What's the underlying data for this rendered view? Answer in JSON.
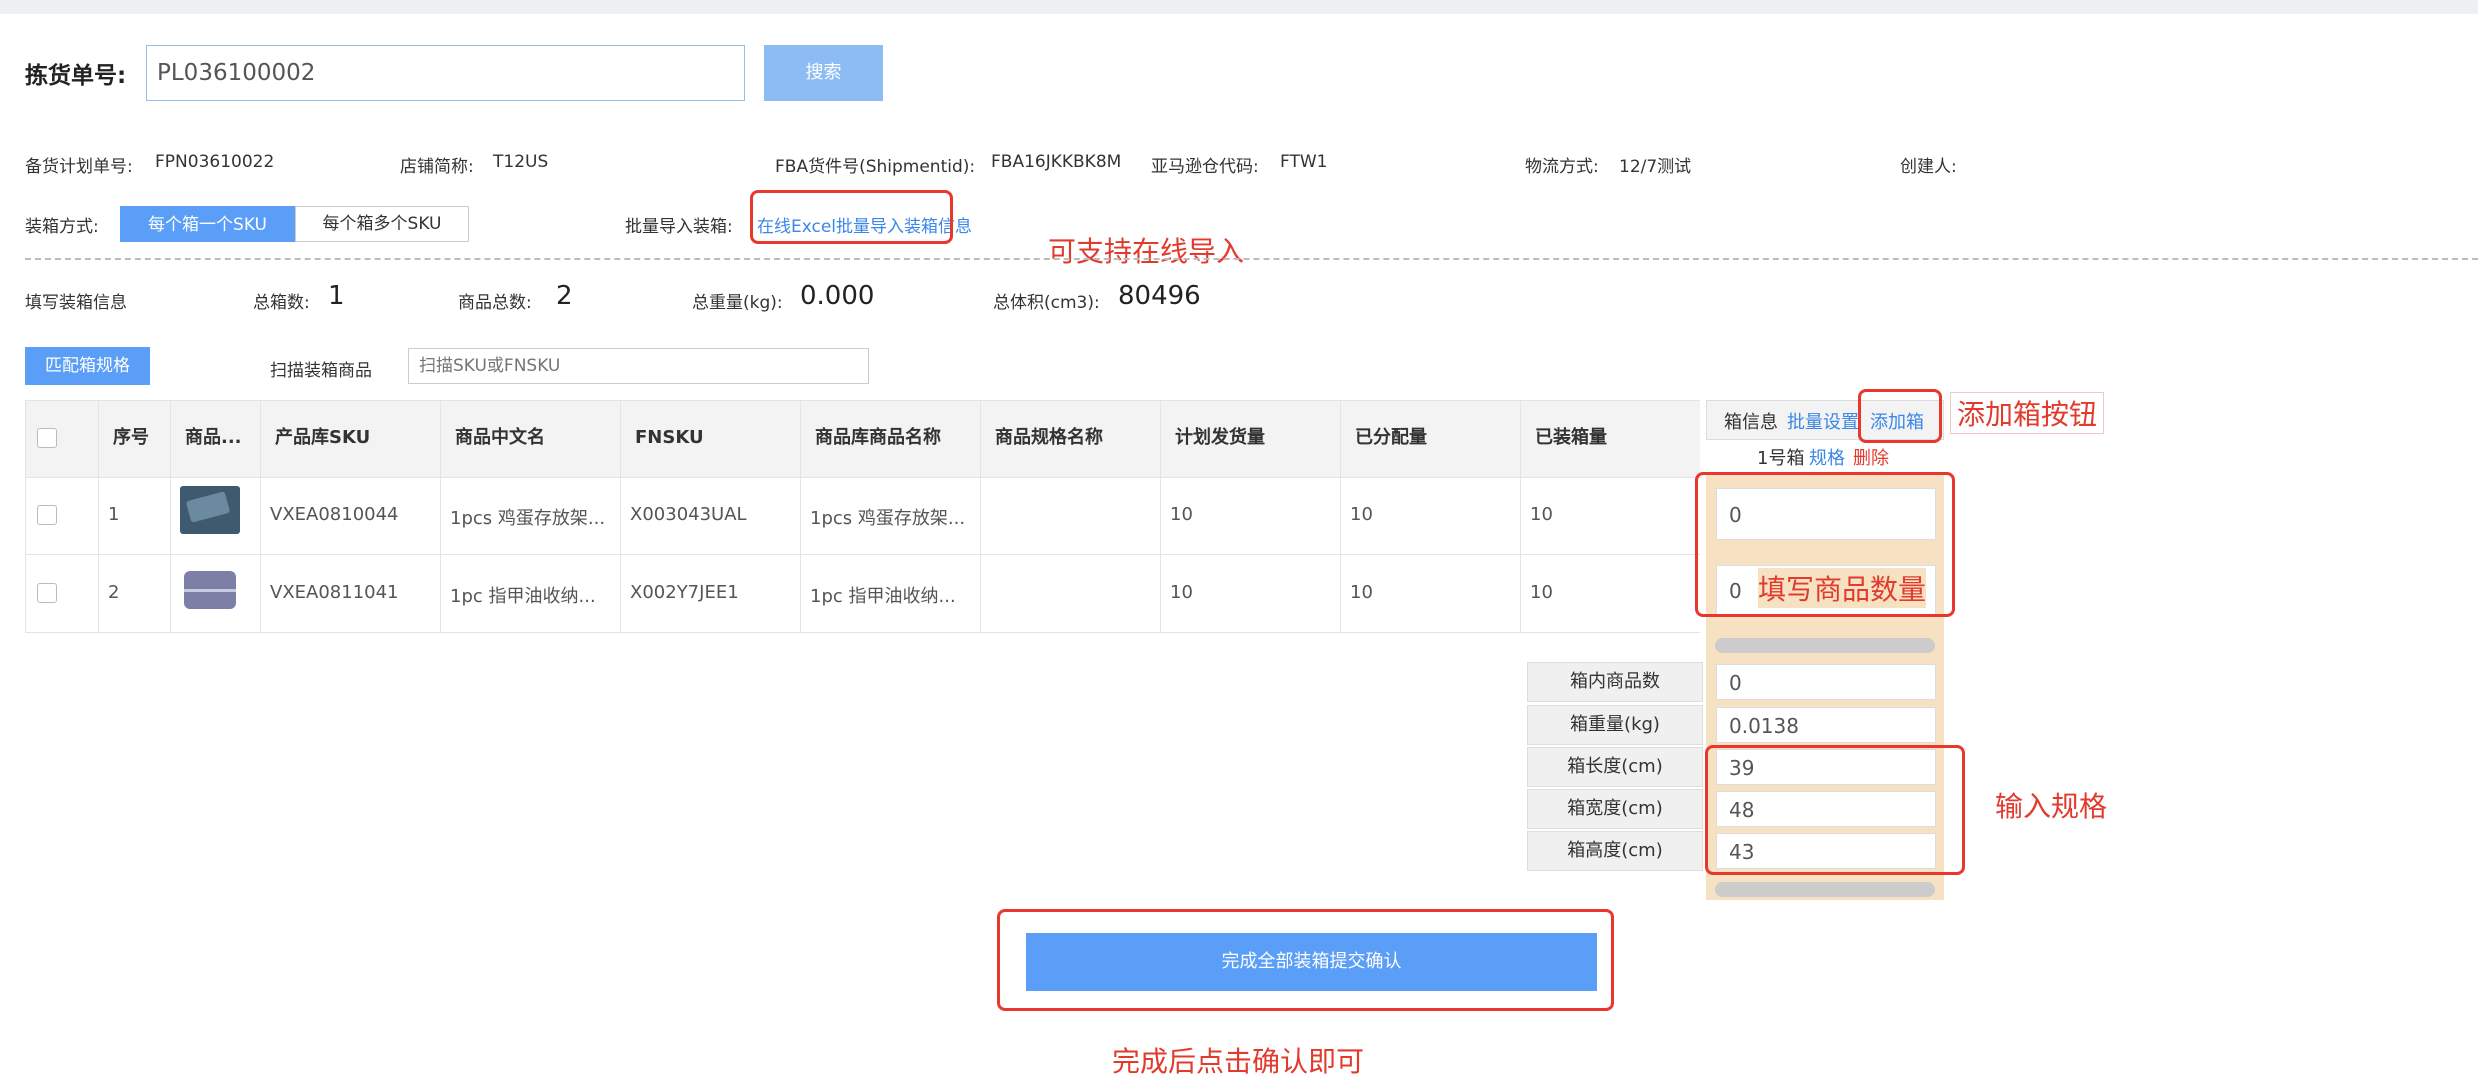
{
  "header": {
    "pick_label": "拣货单号:",
    "pick_value": "PL036100002",
    "search_button": "搜索"
  },
  "info": {
    "plan_label": "备货计划单号:",
    "plan_value": "FPN03610022",
    "shop_label": "店铺简称:",
    "shop_value": "T12US",
    "fba_label": "FBA货件号(Shipmentid):",
    "fba_value": "FBA16JKKBK8M",
    "amazon_label": "亚马逊仓代码:",
    "amazon_value": "FTW1",
    "logistics_label": "物流方式:",
    "logistics_value": "12/7测试",
    "creator_label": "创建人:"
  },
  "packing": {
    "method_label": "装箱方式:",
    "option_single": "每个箱一个SKU",
    "option_multi": "每个箱多个SKU",
    "import_label": "批量导入装箱:",
    "import_link": "在线Excel批量导入装箱信息"
  },
  "summary": {
    "fill_label": "填写装箱信息",
    "total_boxes_label": "总箱数:",
    "total_boxes_value": "1",
    "total_items_label": "商品总数:",
    "total_items_value": "2",
    "total_weight_label": "总重量(kg):",
    "total_weight_value": "0.000",
    "total_volume_label": "总体积(cm3):",
    "total_volume_value": "80496"
  },
  "toolbar": {
    "match_button": "匹配箱规格",
    "scan_label": "扫描装箱商品",
    "scan_placeholder": "扫描SKU或FNSKU"
  },
  "table": {
    "headers": [
      "序号",
      "商品...",
      "产品库SKU",
      "商品中文名",
      "FNSKU",
      "商品库商品名称",
      "商品规格名称",
      "计划发货量",
      "已分配量",
      "已装箱量"
    ],
    "rows": [
      {
        "index": "1",
        "sku": "VXEA0810044",
        "cn_name": "1pcs 鸡蛋存放架...",
        "fnsku": "X003043UAL",
        "lib_name": "1pcs 鸡蛋存放架...",
        "spec": "",
        "planned": "10",
        "allocated": "10",
        "packed": "10",
        "box_qty": "0"
      },
      {
        "index": "2",
        "sku": "VXEA0811041",
        "cn_name": "1pc 指甲油收纳...",
        "fnsku": "X002Y7JEE1",
        "lib_name": "1pc 指甲油收纳...",
        "spec": "",
        "planned": "10",
        "allocated": "10",
        "packed": "10",
        "box_qty": "0"
      }
    ]
  },
  "box_panel": {
    "info_label": "箱信息",
    "batch_link": "批量设置",
    "add_link": "添加箱",
    "box_name": "1号箱",
    "spec_link": "规格",
    "delete_link": "删除",
    "specs": [
      {
        "label": "箱内商品数",
        "value": "0"
      },
      {
        "label": "箱重量(kg)",
        "value": "0.0138"
      },
      {
        "label": "箱长度(cm)",
        "value": "39"
      },
      {
        "label": "箱宽度(cm)",
        "value": "48"
      },
      {
        "label": "箱高度(cm)",
        "value": "43"
      }
    ]
  },
  "submit_button": "完成全部装箱提交确认",
  "annotations": {
    "import_note": "可支持在线导入",
    "add_box_note": "添加箱按钮",
    "qty_note": "填写商品数量",
    "spec_note": "输入规格",
    "confirm_note": "完成后点击确认即可"
  },
  "colors": {
    "accent": "#5a9ef7",
    "annotation_red": "#e23b2e",
    "box_panel_bg": "#f6e1c3"
  }
}
